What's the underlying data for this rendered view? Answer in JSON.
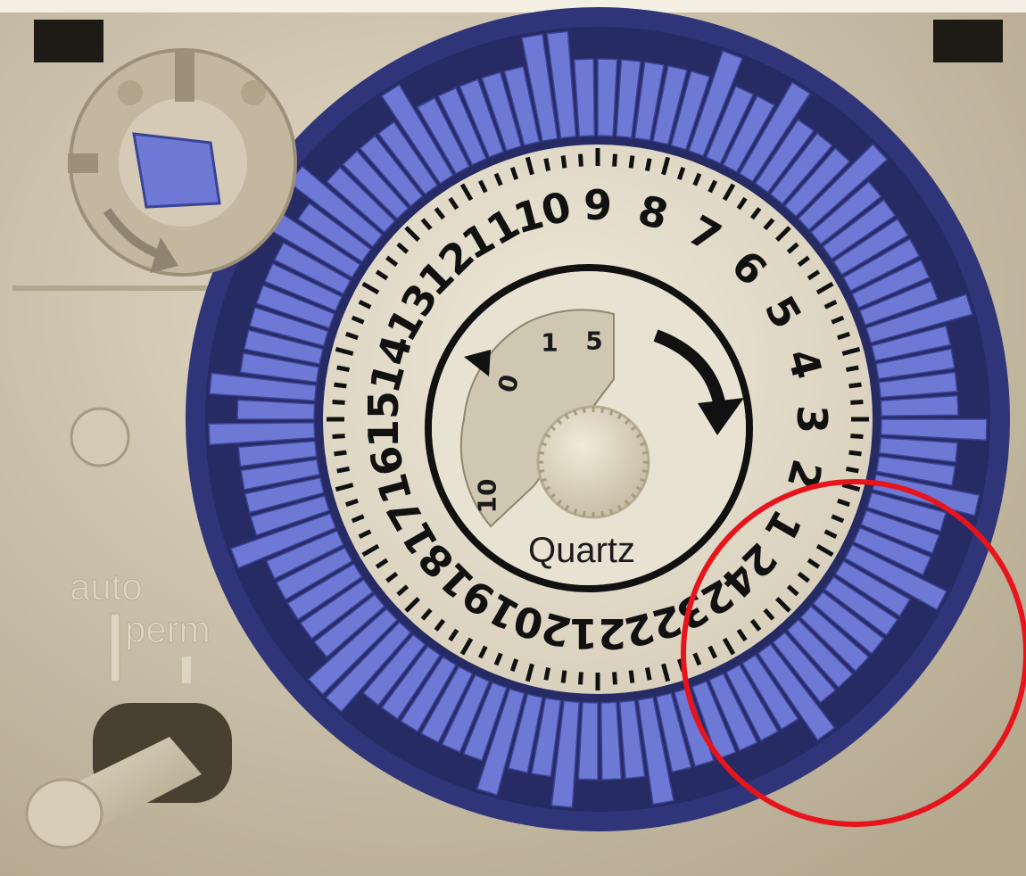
{
  "dial": {
    "hour_labels": [
      "1",
      "2",
      "3",
      "4",
      "5",
      "6",
      "7",
      "8",
      "9",
      "10",
      "11",
      "12",
      "13",
      "14",
      "15",
      "16",
      "17",
      "18",
      "19",
      "20",
      "21",
      "22",
      "23",
      "24"
    ],
    "sub_labels": [
      "0",
      "1",
      "5",
      "10"
    ],
    "brand": "Quartz"
  },
  "switch": {
    "label_top": "auto",
    "label_bottom": "perm"
  },
  "highlight": {
    "color": "#e8141c"
  },
  "colors": {
    "housing": "#c9beaa",
    "segment_blue": "#6e79d6",
    "ring_navy": "#2f3578",
    "dial_face": "#e6dfce"
  }
}
